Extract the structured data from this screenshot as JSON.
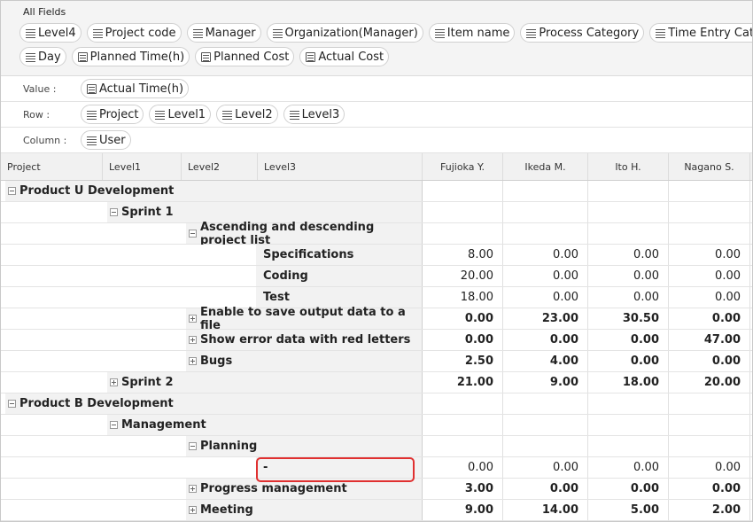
{
  "fields_panel": {
    "title": "All Fields",
    "rows": [
      [
        {
          "label": "Level4",
          "icon": "list-icon"
        },
        {
          "label": "Project code",
          "icon": "list-icon"
        },
        {
          "label": "Manager",
          "icon": "list-icon"
        },
        {
          "label": "Organization(Manager)",
          "icon": "list-icon"
        },
        {
          "label": "Item name",
          "icon": "list-icon"
        },
        {
          "label": "Process Category",
          "icon": "list-icon"
        },
        {
          "label": "Time Entry Category",
          "icon": "list-icon"
        }
      ],
      [
        {
          "label": "Day",
          "icon": "list-icon"
        },
        {
          "label": "Planned Time(h)",
          "icon": "document-icon"
        },
        {
          "label": "Planned Cost",
          "icon": "document-icon"
        },
        {
          "label": "Actual Cost",
          "icon": "document-icon"
        }
      ]
    ]
  },
  "zones": [
    {
      "label": "Value :",
      "chips": [
        {
          "label": "Actual Time(h)",
          "icon": "document-icon"
        }
      ]
    },
    {
      "label": "Row :",
      "chips": [
        {
          "label": "Project",
          "icon": "list-icon"
        },
        {
          "label": "Level1",
          "icon": "list-icon"
        },
        {
          "label": "Level2",
          "icon": "list-icon"
        },
        {
          "label": "Level3",
          "icon": "list-icon"
        }
      ]
    },
    {
      "label": "Column :",
      "chips": [
        {
          "label": "User",
          "icon": "list-icon"
        }
      ]
    }
  ],
  "grid": {
    "row_headers": [
      "Project",
      "Level1",
      "Level2",
      "Level3"
    ],
    "users": [
      "Fujioka Y.",
      "Ikeda M.",
      "Ito H.",
      "Nagano S."
    ],
    "rows": [
      {
        "level": 0,
        "label": "Product U Development",
        "toggle": "minus",
        "values": [
          "",
          "",
          "",
          ""
        ],
        "bold": false
      },
      {
        "level": 1,
        "label": "Sprint 1",
        "toggle": "minus",
        "values": [
          "",
          "",
          "",
          ""
        ],
        "bold": false
      },
      {
        "level": 2,
        "label": "Ascending and descending project list",
        "toggle": "minus",
        "values": [
          "",
          "",
          "",
          ""
        ],
        "bold": false
      },
      {
        "level": 3,
        "label": "Specifications",
        "toggle": "none",
        "values": [
          "8.00",
          "0.00",
          "0.00",
          "0.00"
        ],
        "bold": false
      },
      {
        "level": 3,
        "label": "Coding",
        "toggle": "none",
        "values": [
          "20.00",
          "0.00",
          "0.00",
          "0.00"
        ],
        "bold": false
      },
      {
        "level": 3,
        "label": "Test",
        "toggle": "none",
        "values": [
          "18.00",
          "0.00",
          "0.00",
          "0.00"
        ],
        "bold": false
      },
      {
        "level": 2,
        "label": "Enable to save output data to a file",
        "toggle": "plus",
        "values": [
          "0.00",
          "23.00",
          "30.50",
          "0.00"
        ],
        "bold": true
      },
      {
        "level": 2,
        "label": "Show error data with red letters",
        "toggle": "plus",
        "values": [
          "0.00",
          "0.00",
          "0.00",
          "47.00"
        ],
        "bold": true
      },
      {
        "level": 2,
        "label": "Bugs",
        "toggle": "plus",
        "values": [
          "2.50",
          "4.00",
          "0.00",
          "0.00"
        ],
        "bold": true
      },
      {
        "level": 1,
        "label": "Sprint 2",
        "toggle": "plus",
        "values": [
          "21.00",
          "9.00",
          "18.00",
          "20.00"
        ],
        "bold": true
      },
      {
        "level": 0,
        "label": "Product B Development",
        "toggle": "minus",
        "values": [
          "",
          "",
          "",
          ""
        ],
        "bold": false
      },
      {
        "level": 1,
        "label": "Management",
        "toggle": "minus",
        "values": [
          "",
          "",
          "",
          ""
        ],
        "bold": false
      },
      {
        "level": 2,
        "label": "Planning",
        "toggle": "minus",
        "values": [
          "",
          "",
          "",
          ""
        ],
        "bold": false
      },
      {
        "level": 3,
        "label": "-",
        "toggle": "none",
        "values": [
          "0.00",
          "0.00",
          "0.00",
          "0.00"
        ],
        "bold": false
      },
      {
        "level": 2,
        "label": "Progress management",
        "toggle": "plus",
        "values": [
          "3.00",
          "0.00",
          "0.00",
          "0.00"
        ],
        "bold": true
      },
      {
        "level": 2,
        "label": "Meeting",
        "toggle": "plus",
        "values": [
          "9.00",
          "14.00",
          "5.00",
          "2.00"
        ],
        "bold": true
      }
    ]
  },
  "colors": {
    "highlight": "#e03030",
    "header_bg": "#f1f1f1",
    "panel_bg": "#f4f4f4"
  }
}
